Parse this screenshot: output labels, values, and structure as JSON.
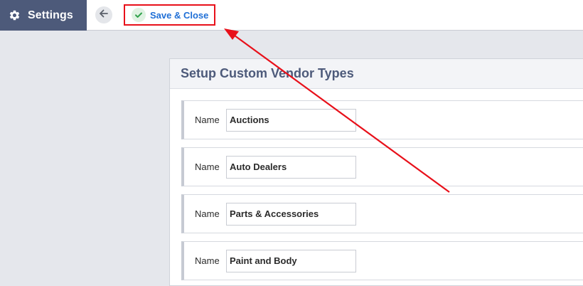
{
  "header": {
    "title": "Settings",
    "save_close_label": "Save & Close"
  },
  "panel": {
    "title": "Setup Custom Vendor Types",
    "rows": [
      {
        "label": "Name",
        "value": "Auctions"
      },
      {
        "label": "Name",
        "value": "Auto Dealers"
      },
      {
        "label": "Name",
        "value": "Parts & Accessories"
      },
      {
        "label": "Name",
        "value": "Paint and Body"
      }
    ]
  },
  "colors": {
    "brand": "#4d5a7a",
    "link": "#1f6fd6",
    "annotation": "#e8101a",
    "success": "#2fa14a"
  },
  "icons": {
    "settings": "gear-icon",
    "back": "arrow-left-icon",
    "save": "check-icon"
  }
}
